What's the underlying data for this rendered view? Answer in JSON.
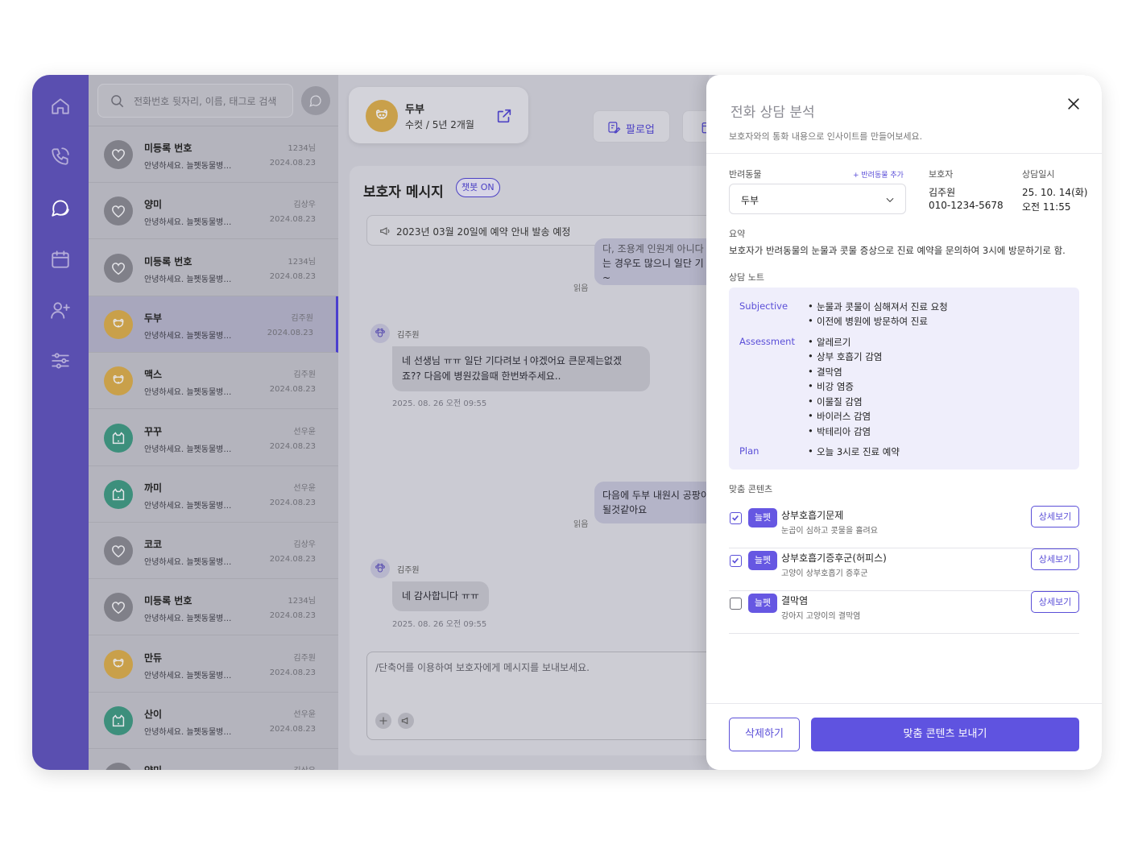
{
  "nav": {
    "items": [
      "home",
      "calls",
      "messages",
      "calendar",
      "add-user",
      "settings"
    ]
  },
  "search": {
    "placeholder": "전화번호 뒷자리, 이름, 태그로 검색"
  },
  "conversations": [
    {
      "name": "미등록 번호",
      "preview": "안녕하세요. 늘펫동물병…",
      "owner": "1234님",
      "date": "2024.08.23",
      "avatar": "heart",
      "color": "gray"
    },
    {
      "name": "양미",
      "preview": "안녕하세요. 늘펫동물병…",
      "owner": "김상우",
      "date": "2024.08.23",
      "avatar": "heart",
      "color": "gray"
    },
    {
      "name": "미등록 번호",
      "preview": "안녕하세요. 늘펫동물병…",
      "owner": "1234님",
      "date": "2024.08.23",
      "avatar": "heart",
      "color": "gray"
    },
    {
      "name": "두부",
      "preview": "안녕하세요. 늘펫동물병…",
      "owner": "김주원",
      "date": "2024.08.23",
      "avatar": "dog",
      "color": "orange",
      "selected": true
    },
    {
      "name": "맥스",
      "preview": "안녕하세요. 늘펫동물병…",
      "owner": "김주원",
      "date": "2024.08.23",
      "avatar": "dog",
      "color": "orange"
    },
    {
      "name": "꾸꾸",
      "preview": "안녕하세요. 늘펫동물병…",
      "owner": "선우윤",
      "date": "2024.08.23",
      "avatar": "cat",
      "color": "green"
    },
    {
      "name": "까미",
      "preview": "안녕하세요. 늘펫동물병…",
      "owner": "선우윤",
      "date": "2024.08.23",
      "avatar": "cat",
      "color": "green"
    },
    {
      "name": "코코",
      "preview": "안녕하세요. 늘펫동물병…",
      "owner": "김상우",
      "date": "2024.08.23",
      "avatar": "heart",
      "color": "gray"
    },
    {
      "name": "미등록 번호",
      "preview": "안녕하세요. 늘펫동물병…",
      "owner": "1234님",
      "date": "2024.08.23",
      "avatar": "heart",
      "color": "gray"
    },
    {
      "name": "만듀",
      "preview": "안녕하세요. 늘펫동물병…",
      "owner": "김주원",
      "date": "2024.08.23",
      "avatar": "dog",
      "color": "orange"
    },
    {
      "name": "산이",
      "preview": "안녕하세요. 늘펫동물병…",
      "owner": "선우윤",
      "date": "2024.08.23",
      "avatar": "cat",
      "color": "green"
    },
    {
      "name": "양미",
      "preview": "",
      "owner": "김상우",
      "date": "",
      "avatar": "heart",
      "color": "gray"
    }
  ],
  "pet_card": {
    "name": "두부",
    "info": "수컷 / 5년 2개월"
  },
  "toolbar": {
    "followup_label": "팔로업"
  },
  "messages": {
    "title": "보호자 메시지",
    "chatbot_badge": "챗봇 ON",
    "notice": "2023년 03월 20일에 예약 안내 발송 예정",
    "outgoing_1": [
      "다, 조용계 인원계 아니다",
      "는 경우도 많으니 일단 기",
      "~"
    ],
    "read_1": "읽음",
    "sender_1": "김주원",
    "incoming_1": [
      "네 선생님 ㅠㅠ 일단 기다려보ㅓ야겠어요 큰문제는없겠",
      "죠?? 다음에 병원갔을때 한번봐주세요.."
    ],
    "time_1": "2025. 08. 26 오전 09:55",
    "outgoing_2": [
      "다음에 두부 내원시 공팡이",
      "될것같아요"
    ],
    "read_2": "읽음",
    "sender_2": "김주원",
    "incoming_2": "네 감사합니다 ㅠㅠ",
    "time_2": "2025. 08. 26 오전 09:55",
    "composer_placeholder": "/단축어를 이용하여 보호자에게 메시지를 보내보세요."
  },
  "drawer": {
    "title": "전화 상담 분석",
    "subtitle": "보호자와의 통화 내용으로 인사이트를 만들어보세요.",
    "pet_label": "반려동물",
    "add_pet": "+ 반려동물 추가",
    "pet_selected": "두부",
    "guardian_label": "보호자",
    "guardian_name": "김주원",
    "guardian_phone": "010-1234-5678",
    "datetime_label": "상담일시",
    "date": "25. 10. 14(화)",
    "time": "오전 11:55",
    "summary_label": "요약",
    "summary": "보호자가 반려동물의 눈물과 콧물 증상으로 진료 예약을 문의하여 3시에 방문하기로 함.",
    "notes_label": "상담 노트",
    "notes": {
      "subjective_label": "Subjective",
      "subjective": [
        "눈물과 콧물이 심해져서 진료 요청",
        "이전에 병원에 방문하여 진료"
      ],
      "assessment_label": "Assessment",
      "assessment": [
        "알레르기",
        "상부 호흡기 감염",
        "결막염",
        "비강 염증",
        "이물질 감염",
        "바이러스 감염",
        "박테리아 감염"
      ],
      "plan_label": "Plan",
      "plan": [
        "오늘 3시로 진료 예약"
      ]
    },
    "contents_label": "맞춤 콘텐츠",
    "contents": [
      {
        "tag": "늘펫",
        "title": "상부호흡기문제",
        "desc": "눈곱이 심하고 콧물을 흘려요",
        "checked": true,
        "button": "상세보기"
      },
      {
        "tag": "늘펫",
        "title": "상부호흡기증후군(허피스)",
        "desc": "고양이 상부호흡기 증후군",
        "checked": true,
        "button": "상세보기"
      },
      {
        "tag": "늘펫",
        "title": "결막염",
        "desc": "강아지 고양이의 결막염",
        "checked": false,
        "button": "상세보기"
      }
    ],
    "delete_label": "삭제하기",
    "send_label": "맞춤 콘텐츠 보내기"
  }
}
